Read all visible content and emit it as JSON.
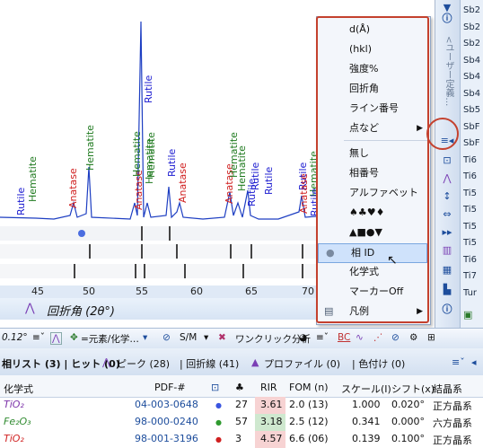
{
  "chart": {
    "x_ticks": [
      "45",
      "50",
      "55",
      "60",
      "65",
      "70"
    ],
    "x_axis_title": "回折角 (2θ°)",
    "peak_labels": [
      {
        "text": "Rutile",
        "color": "#1a1ad0"
      },
      {
        "text": "Hematite",
        "color": "#1f7a1f"
      },
      {
        "text": "Anatase",
        "color": "#d02020"
      },
      {
        "text": "Hematite",
        "color": "#1f7a1f"
      },
      {
        "text": "Anatase",
        "color": "#d02020"
      },
      {
        "text": "Hematite",
        "color": "#1f7a1f"
      },
      {
        "text": "Rutile",
        "color": "#1a1ad0"
      },
      {
        "text": "Anatase",
        "color": "#d02020"
      },
      {
        "text": "Hematite",
        "color": "#1f7a1f"
      },
      {
        "text": "Rutile",
        "color": "#1a1ad0"
      },
      {
        "text": "Hematite",
        "color": "#1f7a1f"
      },
      {
        "text": "Anatase",
        "color": "#d02020"
      },
      {
        "text": "Hematite",
        "color": "#1f7a1f"
      },
      {
        "text": "Hematite",
        "color": "#1f7a1f"
      },
      {
        "text": "Rutile",
        "color": "#1a1ad0"
      },
      {
        "text": "Rutile",
        "color": "#1a1ad0"
      },
      {
        "text": "Anatase",
        "color": "#d02020"
      },
      {
        "text": "Hematite",
        "color": "#1f7a1f"
      },
      {
        "text": "Rutile",
        "color": "#1a1ad0"
      },
      {
        "text": "Rutile",
        "color": "#1a1ad0"
      },
      {
        "text": "Rutile",
        "color": "#1a1ad0"
      }
    ]
  },
  "menu": {
    "items": [
      "d(Å)",
      "(hkl)",
      "強度%",
      "回折角",
      "ライン番号",
      "点など"
    ],
    "items2": [
      "無し",
      "相番号",
      "アルファベット",
      "♠♣♥♦",
      "▲■●▼",
      "相 ID",
      "化学式",
      "マーカーOff",
      "凡例"
    ],
    "selected": "相 ID"
  },
  "sidebar_vertical_label": "<ユーザー定義…",
  "scroll_list": [
    "Sb2",
    "Sb2",
    "Sb2",
    "Sb4",
    "Sb4",
    "Sb4",
    "Sb5",
    "SbF",
    "SbF",
    "Ti6",
    "Ti6",
    "Ti5",
    "Ti5",
    "Ti5",
    "Ti5",
    "Ti6",
    "Ti7",
    "Tur"
  ],
  "toolbar": {
    "angle": "0.12°",
    "element_filter": "=元素/化学…",
    "sm": "S/M",
    "one_click": "ワンクリック分析"
  },
  "tabs": {
    "candidates": "相リスト (3) | ヒット (0)",
    "peaks": "ピーク (28)",
    "lines": "| 回折線 (41)",
    "profile": "プロファイル (0)",
    "color": "| 色付け (0)"
  },
  "table": {
    "headers": [
      "化学式",
      "PDF-#",
      "",
      "",
      "RIR",
      "FOM (n)",
      "スケール(I)",
      "シフト(x)",
      "結晶系"
    ],
    "rows": [
      {
        "formula": "TiO₂",
        "formula_color": "#7a2fa8",
        "pdf": "04-003-0648",
        "dot": "#3a55e0",
        "n": "27",
        "rir": "3.61",
        "fom": "2.0 (13)",
        "scale": "1.000",
        "shift": "0.020°",
        "system": "正方晶系"
      },
      {
        "formula": "Fe₂O₃",
        "formula_color": "#2f8a2f",
        "pdf": "98-000-0240",
        "dot": "#2f9a2f",
        "n": "57",
        "rir": "3.18",
        "fom": "2.5 (12)",
        "scale": "0.341",
        "shift": "0.000°",
        "system": "六方晶系"
      },
      {
        "formula": "TiO₂",
        "formula_color": "#d02020",
        "pdf": "98-001-3196",
        "dot": "#d02020",
        "n": "3",
        "rir": "4.57",
        "fom": "6.6 (06)",
        "scale": "0.139",
        "shift": "0.100°",
        "system": "正方晶系"
      }
    ]
  }
}
